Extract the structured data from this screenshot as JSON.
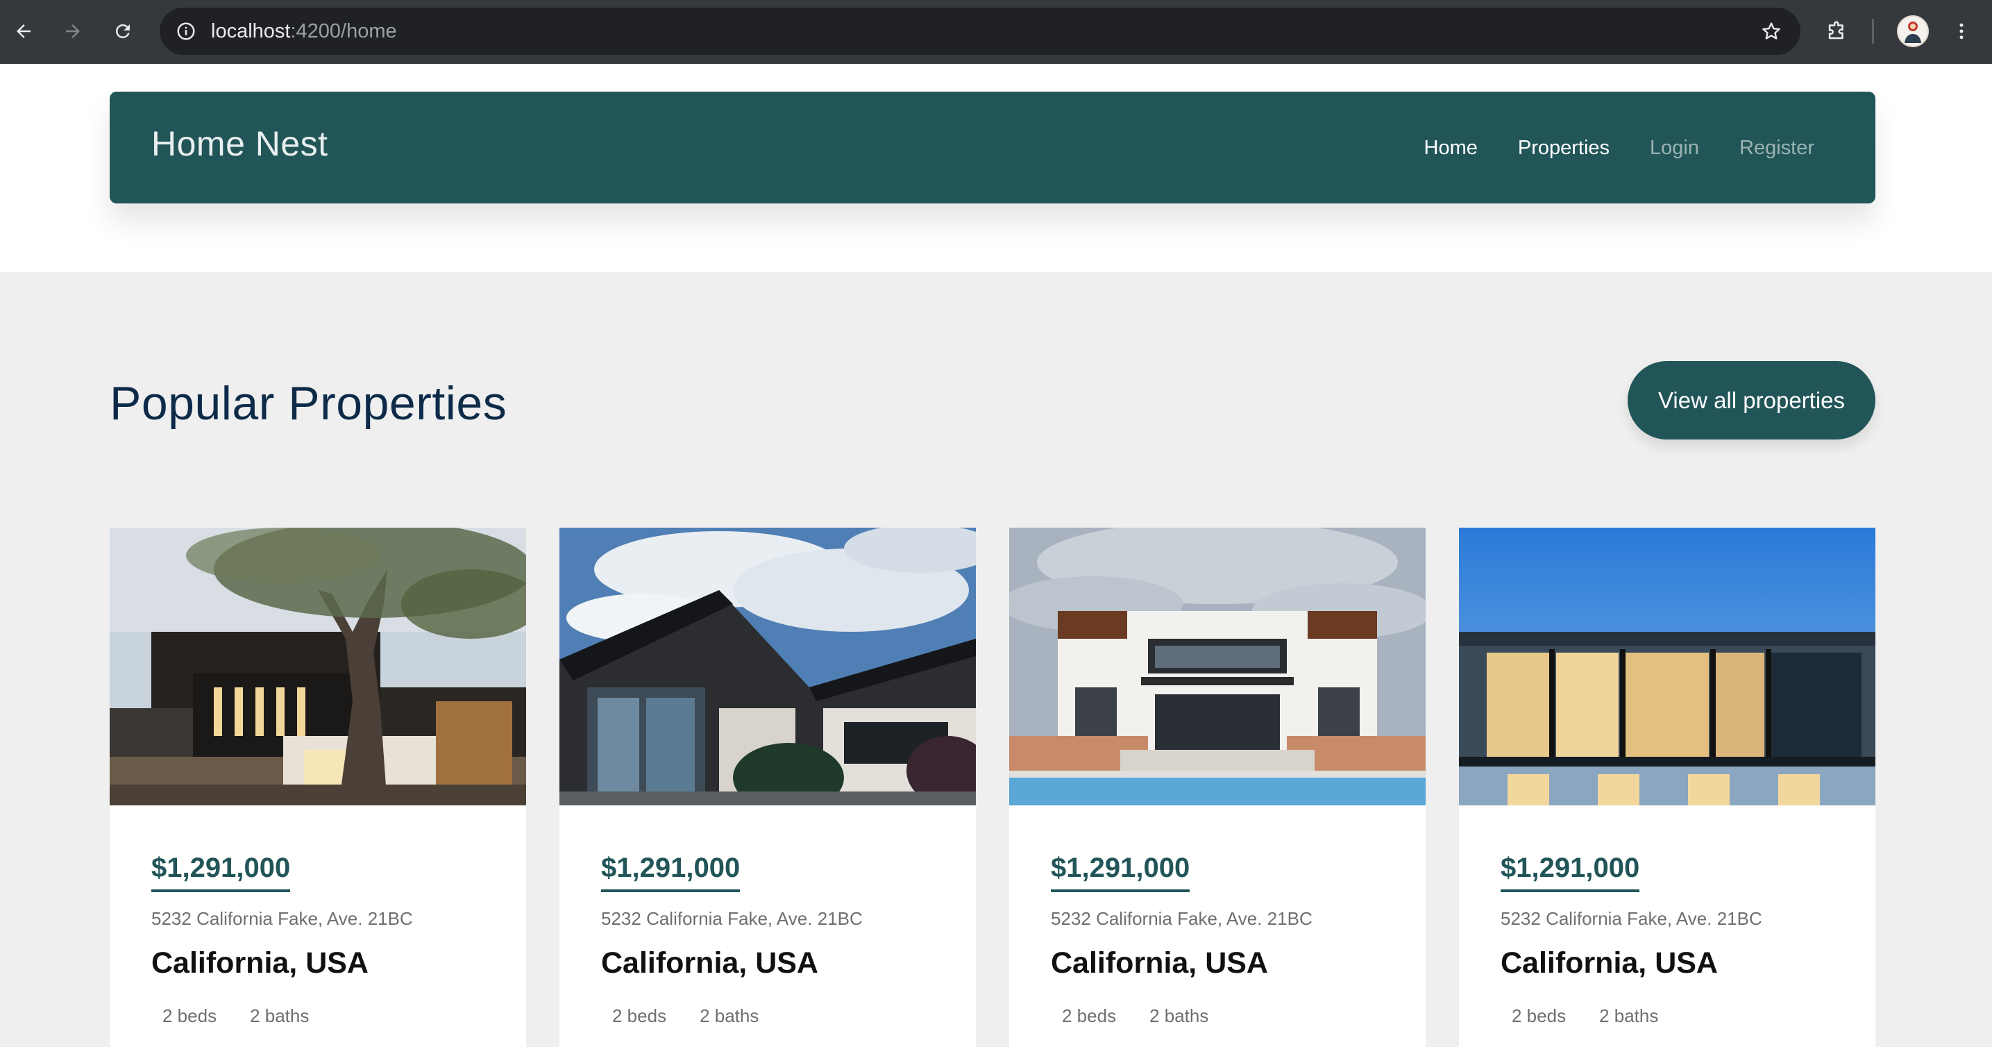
{
  "browser": {
    "url_host": "localhost",
    "url_path": ":4200/home",
    "icons": [
      "back-arrow-icon",
      "forward-arrow-icon",
      "reload-icon",
      "site-info-icon",
      "bookmark-star-icon",
      "extensions-puzzle-icon",
      "profile-avatar",
      "more-vert-icon"
    ]
  },
  "navbar": {
    "brand": "Home Nest",
    "links": [
      {
        "label": "Home",
        "active": true
      },
      {
        "label": "Properties",
        "active": true
      },
      {
        "label": "Login",
        "active": false
      },
      {
        "label": "Register",
        "active": false
      }
    ]
  },
  "section": {
    "title": "Popular Properties",
    "cta": "View all properties"
  },
  "properties": [
    {
      "price": "$1,291,000",
      "address": "5232 California Fake, Ave. 21BC",
      "location": "California, USA",
      "beds": "2 beds",
      "baths": "2 baths",
      "image": "modern house with large tree"
    },
    {
      "price": "$1,291,000",
      "address": "5232 California Fake, Ave. 21BC",
      "location": "California, USA",
      "beds": "2 beds",
      "baths": "2 baths",
      "image": "dark angular house under cloudy sky"
    },
    {
      "price": "$1,291,000",
      "address": "5232 California Fake, Ave. 21BC",
      "location": "California, USA",
      "beds": "2 beds",
      "baths": "2 baths",
      "image": "white villa with pool"
    },
    {
      "price": "$1,291,000",
      "address": "5232 California Fake, Ave. 21BC",
      "location": "California, USA",
      "beds": "2 beds",
      "baths": "2 baths",
      "image": "glass house at dusk"
    }
  ],
  "colors": {
    "brand": "#225558",
    "page_bg": "#efefef",
    "title": "#0d2b49",
    "chrome": "#35393d"
  }
}
